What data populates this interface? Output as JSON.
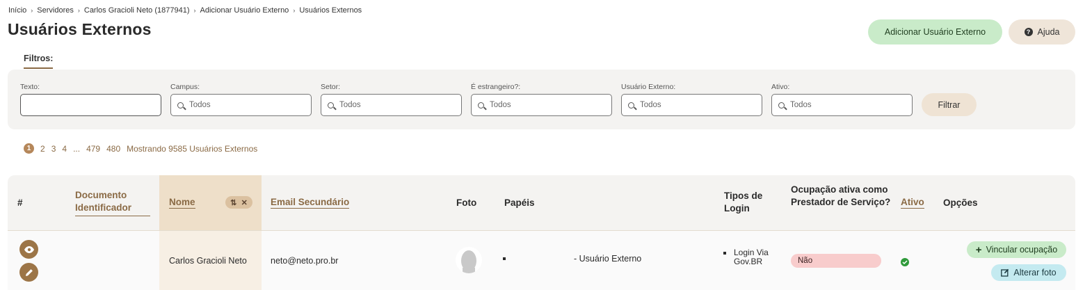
{
  "breadcrumb": [
    "Início",
    "Servidores",
    "Carlos Gracioli Neto (1877941)",
    "Adicionar Usuário Externo",
    "Usuários Externos"
  ],
  "page_title": "Usuários Externos",
  "header": {
    "add_button": "Adicionar Usuário Externo",
    "help_button": "Ajuda"
  },
  "filters": {
    "tab_label": "Filtros:",
    "texto": {
      "label": "Texto:",
      "value": ""
    },
    "campus": {
      "label": "Campus:",
      "value": "Todos"
    },
    "setor": {
      "label": "Setor:",
      "value": "Todos"
    },
    "estrangeiro": {
      "label": "É estrangeiro?:",
      "value": "Todos"
    },
    "usuario_externo": {
      "label": "Usuário Externo:",
      "value": "Todos"
    },
    "ativo": {
      "label": "Ativo:",
      "value": "Todos"
    },
    "submit": "Filtrar"
  },
  "pagination": {
    "current": "1",
    "pages": [
      "2",
      "3",
      "4",
      "...",
      "479",
      "480"
    ],
    "summary": "Mostrando 9585 Usuários Externos"
  },
  "table": {
    "headers": {
      "hash": "#",
      "documento": "Documento Identificador",
      "nome": "Nome",
      "email": "Email Secundário",
      "foto": "Foto",
      "papeis": "Papéis",
      "tipos_login": "Tipos de Login",
      "ocupacao": "Ocupação ativa como Prestador de Serviço?",
      "ativo": "Ativo",
      "opcoes": "Opções"
    },
    "rows": [
      {
        "documento": "",
        "nome": "Carlos Gracioli Neto",
        "email": "neto@neto.pro.br",
        "papel": "- Usuário Externo",
        "tipo_login": "Login Via Gov.BR",
        "ocupacao": "Não",
        "ativo": true,
        "vincular_label": "Vincular ocupação",
        "alterar_foto_label": "Alterar foto"
      }
    ]
  },
  "colors": {
    "accent": "#8a6a45",
    "success_bg": "#c9ebc9",
    "danger_bg": "#f8cccc",
    "info_bg": "#c4eaf0"
  }
}
